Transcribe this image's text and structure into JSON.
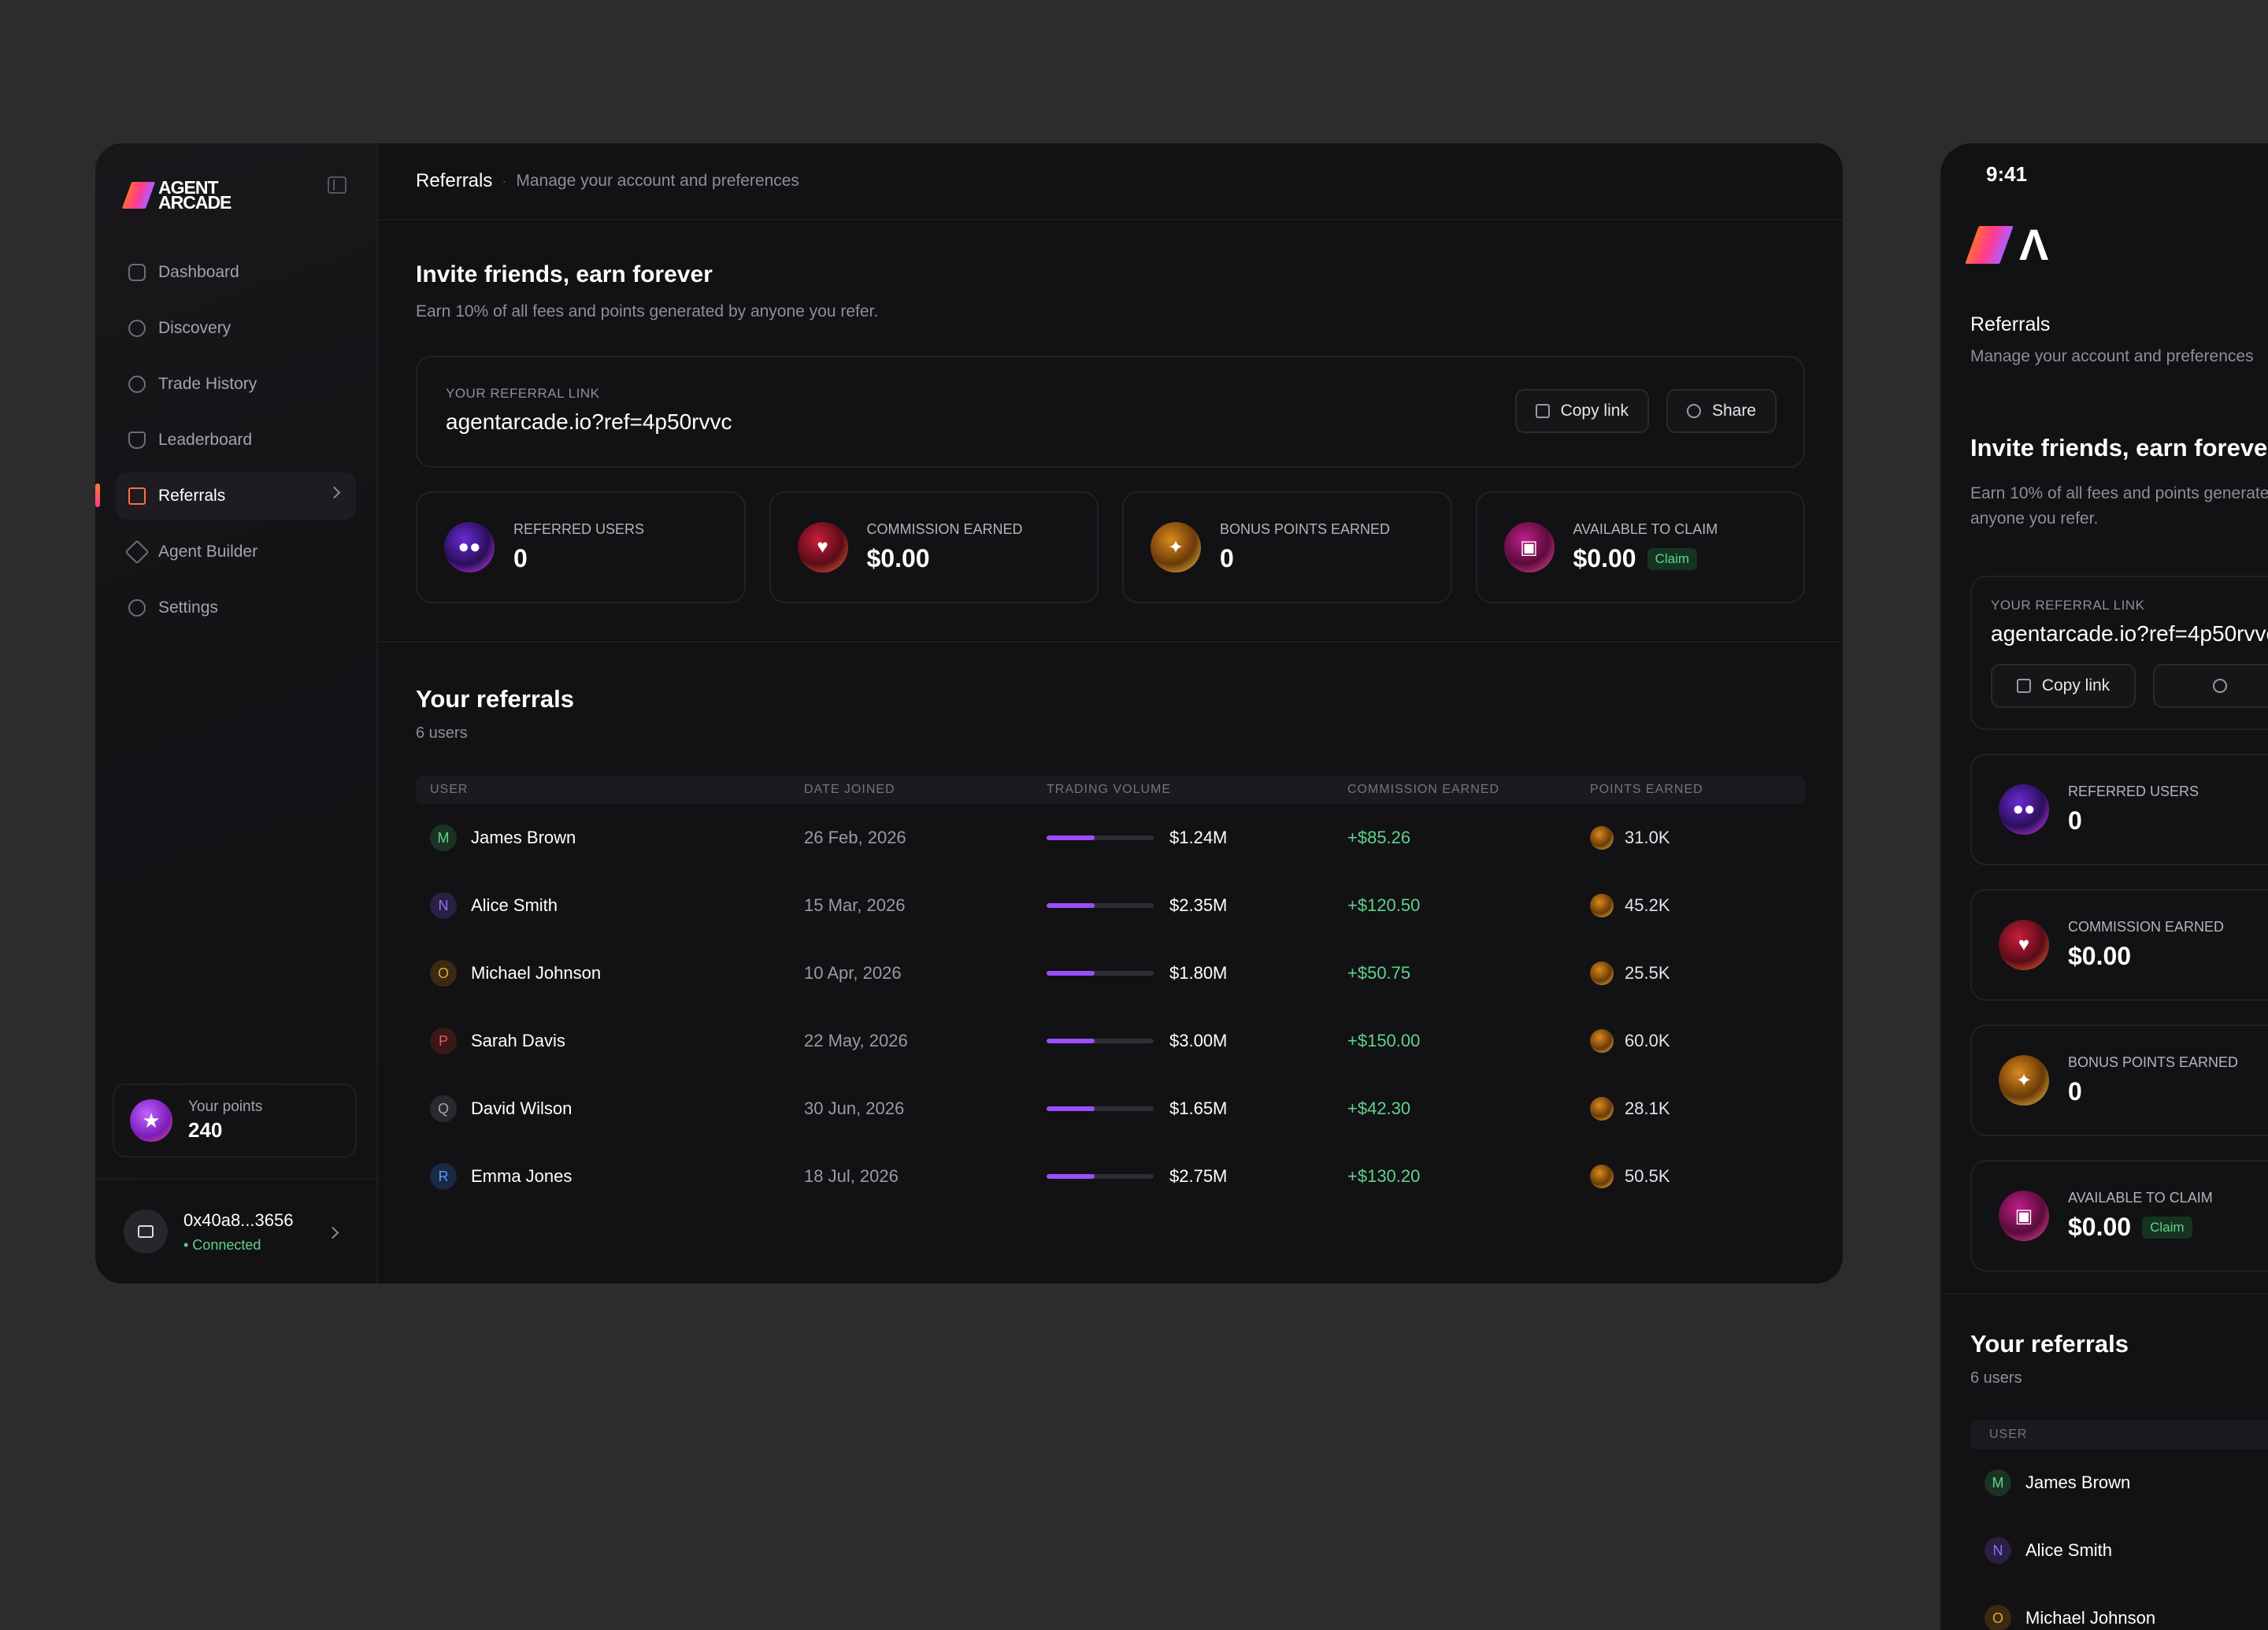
{
  "app": {
    "logo_text_1": "AGENT",
    "logo_text_2": "ARCADE"
  },
  "sidebar": {
    "items": [
      {
        "label": "Dashboard",
        "icon": "grid-icon"
      },
      {
        "label": "Discovery",
        "icon": "compass-icon"
      },
      {
        "label": "Trade History",
        "icon": "history-icon"
      },
      {
        "label": "Leaderboard",
        "icon": "trophy-icon"
      },
      {
        "label": "Referrals",
        "icon": "gift-icon",
        "active": true
      },
      {
        "label": "Agent Builder",
        "icon": "sparkle-icon"
      },
      {
        "label": "Settings",
        "icon": "gear-icon"
      }
    ],
    "points_label": "Your points",
    "points_value": "240",
    "wallet_address": "0x40a8...3656",
    "wallet_status": "• Connected"
  },
  "header": {
    "title": "Referrals",
    "separator": "·",
    "subtitle": "Manage your account and preferences"
  },
  "invite": {
    "title": "Invite friends, earn forever",
    "subtitle": "Earn 10% of all fees and points generated by anyone you refer.",
    "mobile_subtitle": "Earn 10% of all fees and points generated by anyone you refer.",
    "link_label": "YOUR REFERRAL LINK",
    "link": "agentarcade.io?ref=4p50rvvc",
    "copy_label": "Copy link",
    "share_label": "Share"
  },
  "stats": [
    {
      "label": "REFERRED USERS",
      "value": "0",
      "orb": "purple",
      "icon": "users-icon"
    },
    {
      "label": "COMMISSION EARNED",
      "value": "$0.00",
      "orb": "red",
      "icon": "heart-dollar-icon"
    },
    {
      "label": "BONUS POINTS EARNED",
      "value": "0",
      "orb": "gold",
      "icon": "star-badge-icon"
    },
    {
      "label": "AVAILABLE TO CLAIM",
      "value": "$0.00",
      "orb": "pink",
      "icon": "gift-icon",
      "badge": "Claim"
    }
  ],
  "referrals": {
    "title": "Your referrals",
    "count": "6 users",
    "columns": [
      "USER",
      "DATE JOINED",
      "TRADING VOLUME",
      "COMMISSION EARNED",
      "POINTS EARNED"
    ],
    "rows": [
      {
        "initial": "M",
        "name": "James Brown",
        "date": "26 Feb, 2026",
        "volume": "$1.24M",
        "volume_fill": 0.45,
        "commission": "+$85.26",
        "points": "31.0K",
        "color": "#5fd38a",
        "bg": "#1c3324"
      },
      {
        "initial": "N",
        "name": "Alice Smith",
        "date": "15 Mar, 2026",
        "volume": "$2.35M",
        "volume_fill": 0.45,
        "commission": "+$120.50",
        "points": "45.2K",
        "color": "#9b6cff",
        "bg": "#2a1f44"
      },
      {
        "initial": "O",
        "name": "Michael Johnson",
        "date": "10 Apr, 2026",
        "volume": "$1.80M",
        "volume_fill": 0.45,
        "commission": "+$50.75",
        "points": "25.5K",
        "color": "#e0a53a",
        "bg": "#3a2a10"
      },
      {
        "initial": "P",
        "name": "Sarah Davis",
        "date": "22 May, 2026",
        "volume": "$3.00M",
        "volume_fill": 0.45,
        "commission": "+$150.00",
        "points": "60.0K",
        "color": "#e05a5a",
        "bg": "#3a1818"
      },
      {
        "initial": "Q",
        "name": "David Wilson",
        "date": "30 Jun, 2026",
        "volume": "$1.65M",
        "volume_fill": 0.45,
        "commission": "+$42.30",
        "points": "28.1K",
        "color": "#a4a3ab",
        "bg": "#2a2a2e"
      },
      {
        "initial": "R",
        "name": "Emma Jones",
        "date": "18 Jul, 2026",
        "volume": "$2.75M",
        "volume_fill": 0.45,
        "commission": "+$130.20",
        "points": "50.5K",
        "color": "#5a9bff",
        "bg": "#182a44"
      }
    ]
  },
  "mobile": {
    "time": "9:41",
    "logo_glyph": "Λ",
    "column_user": "USER",
    "visible_rows": 3
  },
  "colors": {
    "accent": "#9b4dff",
    "positive": "#5fd38a",
    "brand_start": "#ff6a3a",
    "brand_end": "#b15cff"
  }
}
